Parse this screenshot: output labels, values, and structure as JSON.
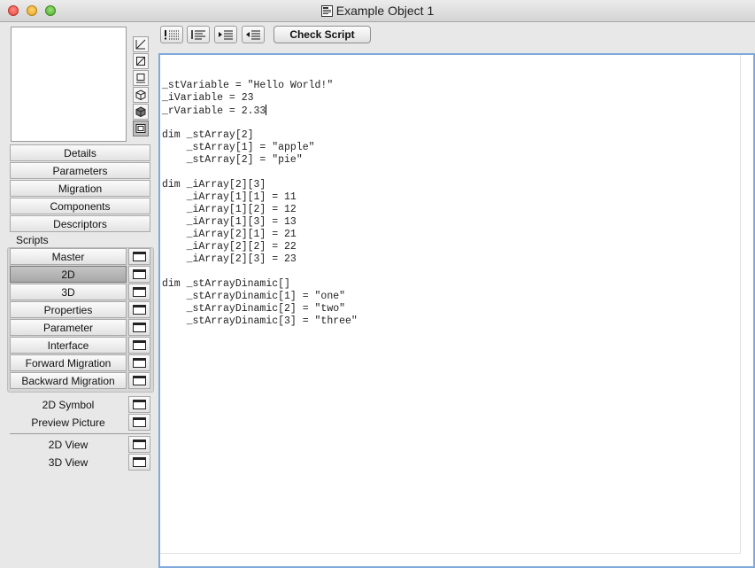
{
  "window": {
    "title": "Example Object 1"
  },
  "sections": {
    "details": "Details",
    "parameters": "Parameters",
    "migration": "Migration",
    "components": "Components",
    "descriptors": "Descriptors"
  },
  "scripts_label": "Scripts",
  "scripts": [
    {
      "label": "Master",
      "selected": false
    },
    {
      "label": "2D",
      "selected": true
    },
    {
      "label": "3D",
      "selected": false
    },
    {
      "label": "Properties",
      "selected": false
    },
    {
      "label": "Parameter",
      "selected": false
    },
    {
      "label": "Interface",
      "selected": false
    },
    {
      "label": "Forward Migration",
      "selected": false
    },
    {
      "label": "Backward Migration",
      "selected": false
    }
  ],
  "extras": {
    "symbol_2d": "2D Symbol",
    "preview_picture": "Preview Picture",
    "view_2d": "2D View",
    "view_3d": "3D View"
  },
  "side_tools": [
    "edit-line-icon",
    "slash-box-icon",
    "monitor-icon",
    "cube-wire-icon",
    "cube-solid-icon",
    "film-icon"
  ],
  "toolbar": {
    "buttons": [
      "insert-breakpoint-icon",
      "format-list-icon",
      "indent-icon",
      "outdent-icon"
    ],
    "check_script": "Check Script"
  },
  "editor": {
    "lines": [
      "",
      "_stVariable = \"Hello World!\"",
      "_iVariable = 23",
      "_rVariable = 2.33",
      "",
      "dim _stArray[2]",
      "    _stArray[1] = \"apple\"",
      "    _stArray[2] = \"pie\"",
      "",
      "dim _iArray[2][3]",
      "    _iArray[1][1] = 11",
      "    _iArray[1][2] = 12",
      "    _iArray[1][3] = 13",
      "    _iArray[2][1] = 21",
      "    _iArray[2][2] = 22",
      "    _iArray[2][3] = 23",
      "",
      "dim _stArrayDinamic[]",
      "    _stArrayDinamic[1] = \"one\"",
      "    _stArrayDinamic[2] = \"two\"",
      "    _stArrayDinamic[3] = \"three\""
    ]
  },
  "colors": {
    "editor_focus": "#7fa9dd",
    "selected_script": "#b4b4b4"
  }
}
